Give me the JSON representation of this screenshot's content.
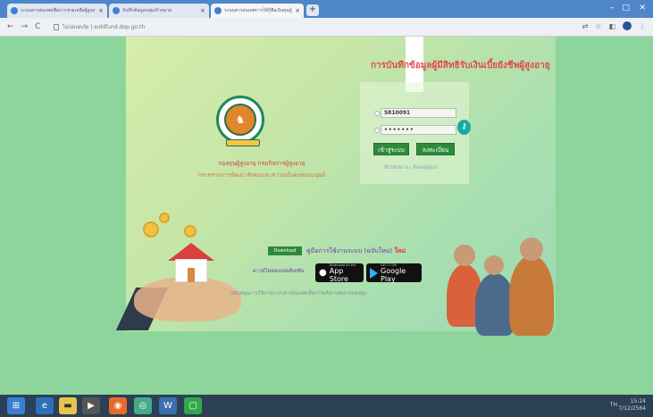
{
  "browser": {
    "tabs": [
      {
        "title": "ระบบสารสนเทศเพื่อการช่วยเหลือผู้สูงอายุ",
        "active": false
      },
      {
        "title": "บันทึกข้อมูลกลุ่มเป้าหมาย",
        "active": false
      },
      {
        "title": "ระบบสารสนเทศการให้กู้ยืมเงินทุนผู้สูงอายุ",
        "active": true
      }
    ],
    "address": "ไม่ปลอดภัย | eoldfund.dop.go.th"
  },
  "page": {
    "title": "การบันทึกข้อมูลผู้มีสิทธิรับเงินเบี้ยยังชีพผู้สูงอายุ",
    "org_line1": "กองทุนผู้สูงอายุ กรมกิจการผู้สูงอายุ",
    "org_line2": "กระทรวงการพัฒนาสังคมและความมั่นคงของมนุษย์",
    "login": {
      "username_value": "5810091",
      "password_value": "•••••••",
      "login_label": "เข้าสู่ระบบ",
      "register_label": "ลงทะเบียน",
      "forgot_text": "ลืมรหัสผ่าน / ติดต่อผู้ดูแล"
    },
    "download_badge": "Download",
    "manual_text": "คู่มือการใช้งานระบบ (ฉบับใหม่)",
    "manual_new": "ใหม่",
    "app_label": "ดาวน์โหลดแอปพลิเคชัน",
    "app_store": {
      "small": "Download on the",
      "large": "App Store"
    },
    "google_play": {
      "small": "GET IT ON",
      "large": "Google Play"
    },
    "footer_note": "สนับสนุนการใช้งานระบบสารสนเทศเพื่อการบริหารจัดการกองทุน"
  },
  "taskbar": {
    "time": "15:24",
    "date": "7/12/2564",
    "tray": "TH"
  },
  "colors": {
    "page_bg": "#8ed59c",
    "title_red": "#e34a4a",
    "button_green": "#2e8a3a",
    "taskbar": "#2b3f55",
    "tabbar": "#4f86c9"
  }
}
